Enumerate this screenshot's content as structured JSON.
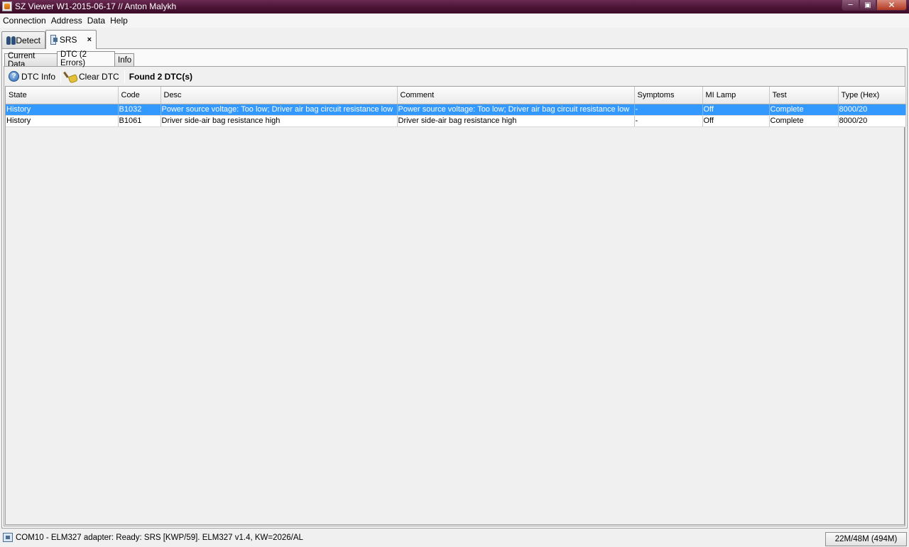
{
  "window": {
    "title": "SZ Viewer W1-2015-06-17 // Anton Malykh",
    "min_glyph": "─",
    "max_glyph": "▣",
    "close_glyph": "✕"
  },
  "menu": [
    "Connection",
    "Address",
    "Data",
    "Help"
  ],
  "top_tabs": {
    "detect": "Detect",
    "srs": "SRS",
    "close_glyph": "×"
  },
  "sub_tabs": {
    "current_data": "Current Data",
    "dtc": "DTC (2 Errors)",
    "info": "Info"
  },
  "toolbar": {
    "dtc_info": "DTC Info",
    "clear_dtc": "Clear DTC",
    "found": "Found 2 DTC(s)"
  },
  "table": {
    "columns": [
      "State",
      "Code",
      "Desc",
      "Comment",
      "Symptoms",
      "MI Lamp",
      "Test",
      "Type (Hex)"
    ],
    "rows": [
      [
        "History",
        "B1032",
        "Power source voltage: Too low; Driver air bag circuit resistance low",
        "Power source voltage: Too low; Driver air bag circuit resistance low",
        "-",
        "Off",
        "Complete",
        "8000/20"
      ],
      [
        "History",
        "B1061",
        "Driver side-air bag resistance high",
        "Driver side-air bag resistance high",
        "-",
        "Off",
        "Complete",
        "8000/20"
      ]
    ],
    "selected_row": 0
  },
  "status": {
    "text": "COM10 - ELM327 adapter: Ready: SRS [KWP/59]. ELM327 v1.4, KW=2026/AL",
    "memory": "22M/48M (494M)"
  },
  "colors": {
    "title_bar": "#4b1334",
    "selection": "#3399ff"
  }
}
